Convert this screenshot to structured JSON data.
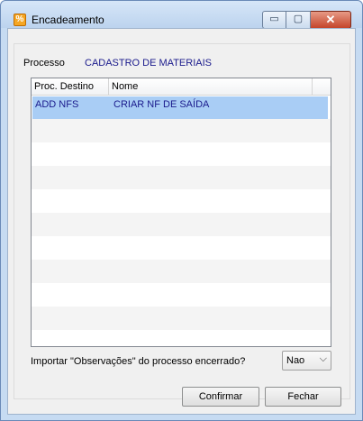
{
  "window": {
    "title": "Encadeamento",
    "app_icon": "app-logo-icon"
  },
  "title_buttons": {
    "minimize": "▭",
    "maximize": "▢",
    "close": "✕"
  },
  "process": {
    "label": "Processo",
    "value": "CADASTRO DE MATERIAIS"
  },
  "grid": {
    "columns": [
      "Proc. Destino",
      "Nome"
    ],
    "rows": [
      {
        "destino": "ADD NFS",
        "nome": "CRIAR NF DE SAÍDA",
        "selected": true
      }
    ]
  },
  "import": {
    "label": "Importar \"Observações\" do processo encerrado?",
    "selected": "Nao"
  },
  "buttons": {
    "confirm": "Confirmar",
    "close": "Fechar"
  },
  "colors": {
    "selected_row": "#a9cdf5",
    "data_text": "#1a1a8c"
  }
}
